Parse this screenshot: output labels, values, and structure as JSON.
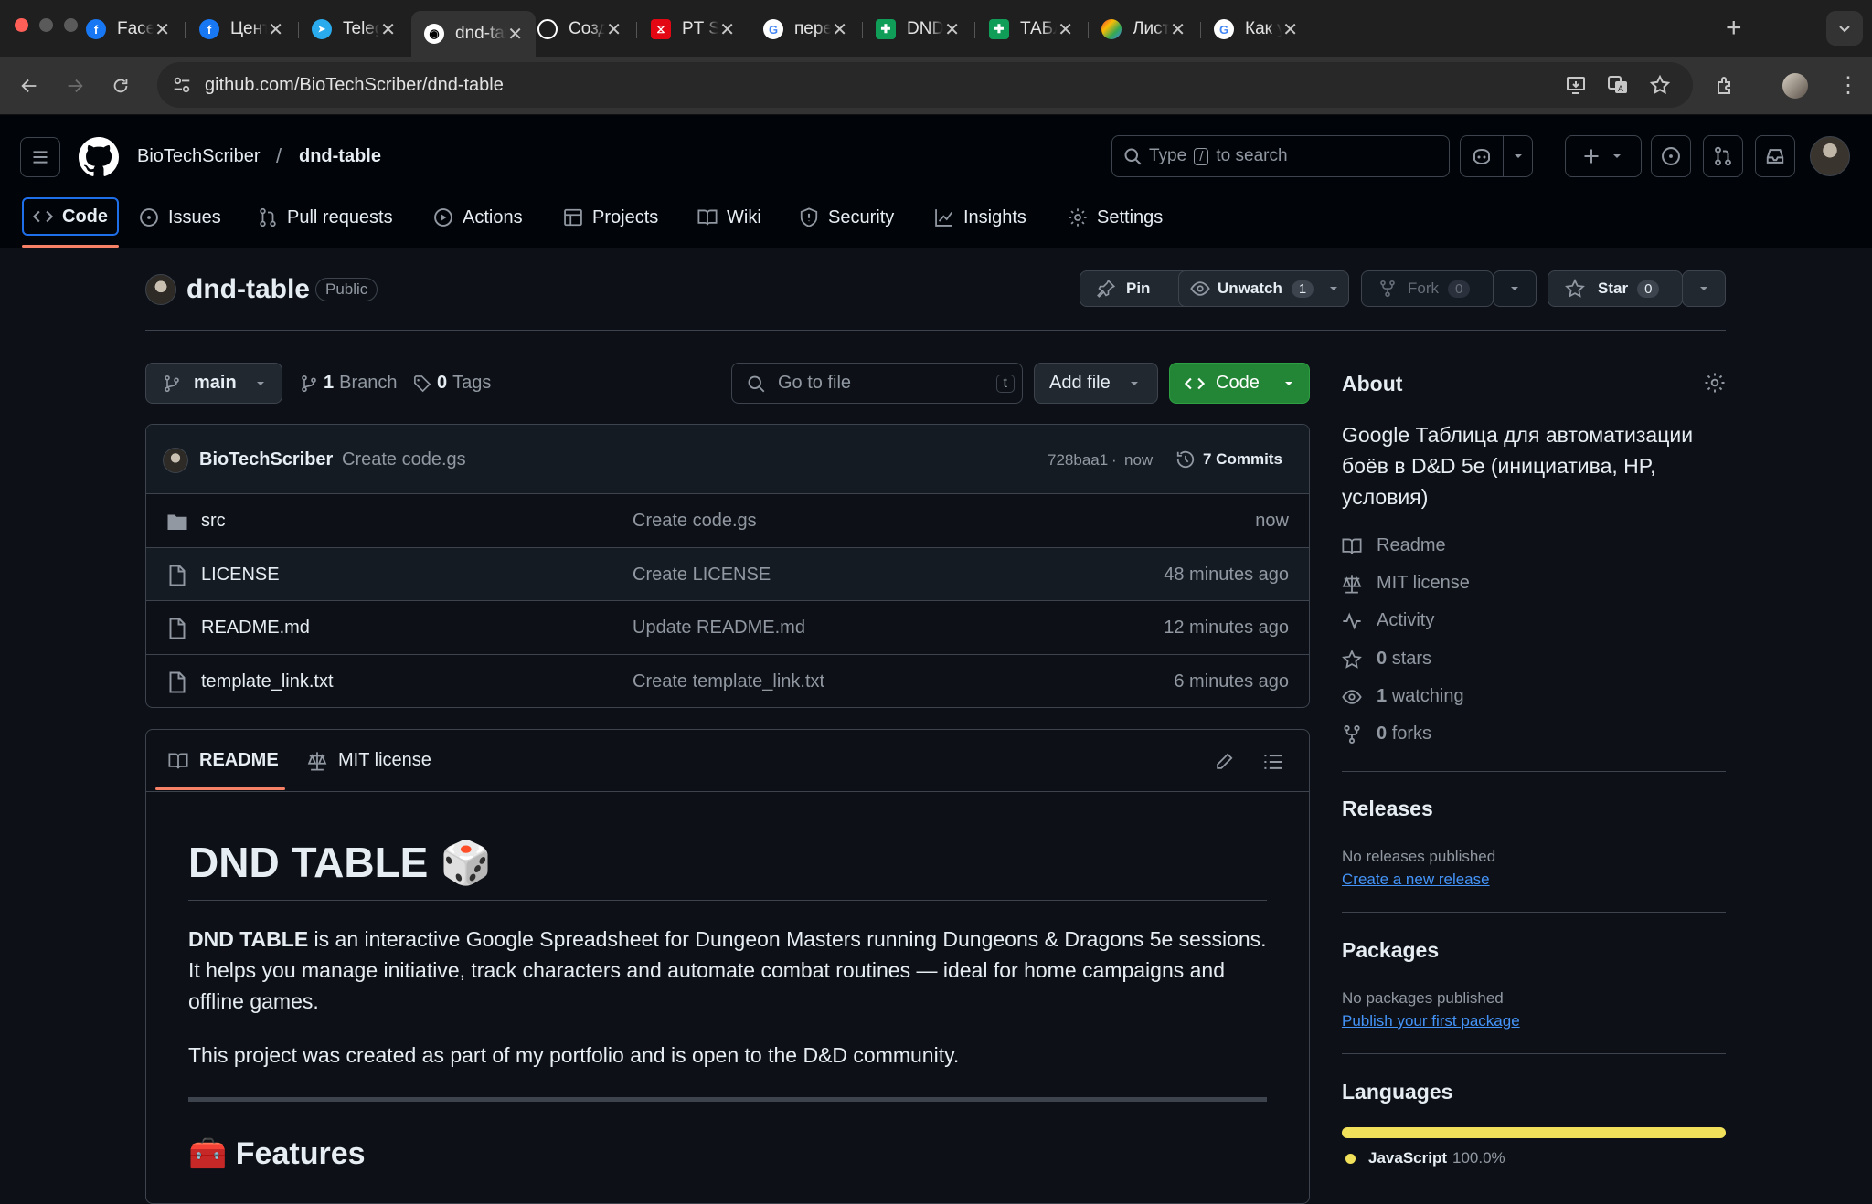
{
  "browser": {
    "tabs": [
      {
        "title": "Facebook",
        "icon": "facebook-icon",
        "color": "#1877f2"
      },
      {
        "title": "Центр аккаунтов",
        "icon": "facebook-icon",
        "color": "#1877f2"
      },
      {
        "title": "Telegram",
        "icon": "telegram-icon",
        "color": "#2aabee"
      },
      {
        "title": "dnd-table",
        "icon": "github-icon",
        "color": "#ffffff"
      },
      {
        "title": "Создание",
        "icon": "openai-icon",
        "color": "#ffffff"
      },
      {
        "title": "PT Start",
        "icon": "pt-icon",
        "color": "#e30613"
      },
      {
        "title": "перевод",
        "icon": "google-icon",
        "color": "#ffffff"
      },
      {
        "title": "DND TABLE",
        "icon": "sheets-icon",
        "color": "#0f9d58"
      },
      {
        "title": "ТАБЛИЦА",
        "icon": "sheets-icon",
        "color": "#0f9d58"
      },
      {
        "title": "Лист Дел",
        "icon": "gemini-icon",
        "color": "#4285f4"
      },
      {
        "title": "Как удалить",
        "icon": "google-icon",
        "color": "#ffffff"
      }
    ],
    "url": "github.com/BioTechScriber/dnd-table"
  },
  "header": {
    "owner": "BioTechScriber",
    "separator": "/",
    "repo": "dnd-table",
    "search_prefix": "Type",
    "search_key": "/",
    "search_suffix": "to search"
  },
  "repo_nav": [
    {
      "label": "Code",
      "icon": "code-icon"
    },
    {
      "label": "Issues",
      "icon": "issue-icon"
    },
    {
      "label": "Pull requests",
      "icon": "pull-request-icon"
    },
    {
      "label": "Actions",
      "icon": "play-icon"
    },
    {
      "label": "Projects",
      "icon": "table-icon"
    },
    {
      "label": "Wiki",
      "icon": "book-icon"
    },
    {
      "label": "Security",
      "icon": "shield-icon"
    },
    {
      "label": "Insights",
      "icon": "graph-icon"
    },
    {
      "label": "Settings",
      "icon": "gear-icon"
    }
  ],
  "repo": {
    "name": "dnd-table",
    "visibility": "Public",
    "pin": "Pin",
    "unwatch": "Unwatch",
    "watch_count": "1",
    "fork": "Fork",
    "fork_count": "0",
    "star": "Star",
    "star_count": "0"
  },
  "toolbar": {
    "branch": "main",
    "branch_count": "1",
    "branch_label": "Branch",
    "tag_count": "0",
    "tag_label": "Tags",
    "goto_placeholder": "Go to file",
    "goto_key": "t",
    "add_file": "Add file",
    "code": "Code"
  },
  "commit": {
    "author": "BioTechScriber",
    "message": "Create code.gs",
    "hash": "728baa1",
    "sep": "·",
    "when": "now",
    "commits": "7 Commits"
  },
  "files": [
    {
      "name": "src",
      "type": "folder",
      "message": "Create code.gs",
      "time": "now"
    },
    {
      "name": "LICENSE",
      "type": "file",
      "message": "Create LICENSE",
      "time": "48 minutes ago"
    },
    {
      "name": "README.md",
      "type": "file",
      "message": "Update README.md",
      "time": "12 minutes ago"
    },
    {
      "name": "template_link.txt",
      "type": "file",
      "message": "Create template_link.txt",
      "time": "6 minutes ago"
    }
  ],
  "readme": {
    "tab1": "README",
    "tab2": "MIT license",
    "title": "DND TABLE 🎲",
    "p1_bold": "DND TABLE",
    "p1_rest": " is an interactive Google Spreadsheet for Dungeon Masters running Dungeons & Dragons 5e sessions. It helps you manage initiative, track characters and automate combat routines — ideal for home campaigns and offline games.",
    "p2": "This project was created as part of my portfolio and is open to the D&D community.",
    "features": "🧰 Features"
  },
  "about": {
    "title": "About",
    "description": "Google Таблица для автоматизации боёв в D&D 5e (инициатива, HP, условия)",
    "links": [
      {
        "label": "Readme",
        "icon": "book-icon"
      },
      {
        "label": "MIT license",
        "icon": "law-icon"
      },
      {
        "label": "Activity",
        "icon": "pulse-icon"
      },
      {
        "count": "0",
        "label": "stars",
        "icon": "star-icon"
      },
      {
        "count": "1",
        "label": "watching",
        "icon": "eye-icon"
      },
      {
        "count": "0",
        "label": "forks",
        "icon": "fork-icon"
      }
    ],
    "releases_title": "Releases",
    "releases_none": "No releases published",
    "releases_link": "Create a new release",
    "packages_title": "Packages",
    "packages_none": "No packages published",
    "packages_link": "Publish your first package",
    "languages_title": "Languages",
    "language": "JavaScript",
    "language_pct": "100.0%",
    "language_color": "#f1e05a"
  }
}
